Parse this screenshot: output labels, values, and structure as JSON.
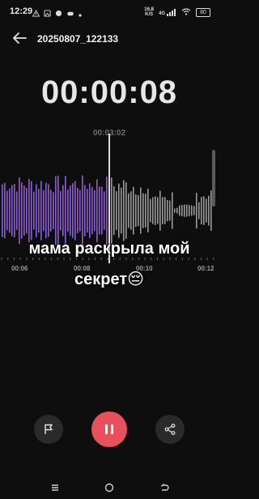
{
  "status_bar": {
    "time": "12:29",
    "net_speed_value": "16,8",
    "net_speed_unit": "K/S",
    "network_type": "4G",
    "battery": "80"
  },
  "header": {
    "title": "20250807_122133"
  },
  "recorder": {
    "elapsed": "00:00:08",
    "total": "00:03:02"
  },
  "timeline": {
    "ticks": [
      "00:06",
      "00:08",
      "00:10",
      "00:12"
    ]
  },
  "caption": {
    "line1": "мама раскрыла мой",
    "line2": "секрет😔"
  },
  "colors": {
    "accent": "#e8505b",
    "wave_played_start": "#5a6be0",
    "wave_played_end": "#c24fd0",
    "wave_unplayed": "#9a9a9a"
  }
}
